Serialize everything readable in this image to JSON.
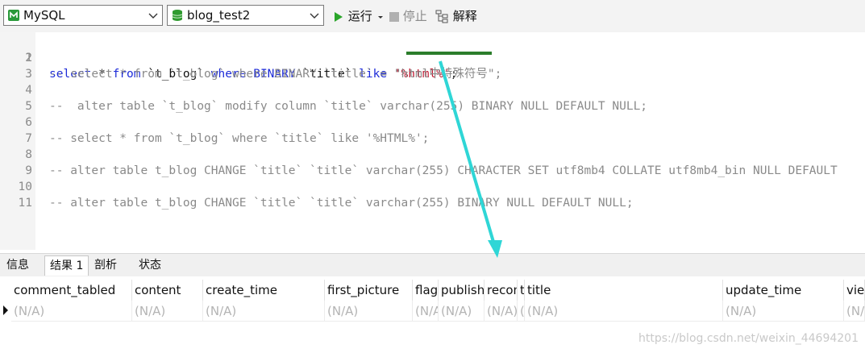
{
  "toolbar": {
    "connection": "MySQL",
    "database": "blog_test2",
    "run_label": "运行",
    "stop_label": "停止",
    "explain_label": "解释",
    "colors": {
      "run": "#2aa52a",
      "db_icon": "#2f9a2f"
    }
  },
  "editor": {
    "lines": [
      {
        "num": "1",
        "kind": "sql"
      },
      {
        "num": "2",
        "text": ""
      },
      {
        "num": "3",
        "text": "-- select * from `t_blog` where BINARY `title` = \"html中特殊符号\";"
      },
      {
        "num": "4",
        "text": ""
      },
      {
        "num": "5",
        "text": "--  alter table `t_blog` modify column `title` varchar(255) BINARY NULL DEFAULT NULL;"
      },
      {
        "num": "6",
        "text": ""
      },
      {
        "num": "7",
        "text": "-- select * from `t_blog` where `title` like '%HTML%';"
      },
      {
        "num": "8",
        "text": ""
      },
      {
        "num": "9",
        "text": "-- alter table t_blog CHANGE `title` `title` varchar(255) CHARACTER SET utf8mb4 COLLATE utf8mb4_bin NULL DEFAULT"
      },
      {
        "num": "10",
        "text": ""
      },
      {
        "num": "11",
        "text": "-- alter table t_blog CHANGE `title` `title` varchar(255) BINARY NULL DEFAULT NULL;"
      }
    ],
    "line1": {
      "kw_select": "select",
      "star": " * ",
      "kw_from": "from",
      "table": " `t_blog` ",
      "kw_where": "where",
      "kw_binary": " BINARY ",
      "col": "`title` ",
      "kw_like": "like",
      "space": " ",
      "pattern": "'%html%'",
      "semi": ";"
    },
    "colors": {
      "keyword": "#1d2bd8",
      "string": "#c0162f",
      "comment": "#8a8a8a"
    }
  },
  "tabs": [
    "信息",
    "结果 1",
    "剖析",
    "状态"
  ],
  "grid": {
    "columns": [
      "comment_tabled",
      "content",
      "create_time",
      "first_picture",
      "flag",
      "publish",
      "recom",
      "t",
      "title",
      "update_time",
      "view"
    ],
    "row": [
      "(N/A)",
      "(N/A)",
      "(N/A)",
      "(N/A)",
      "(N/A)",
      "(N/A)",
      "(N/A)",
      "(",
      "(N/A)",
      "(N/A)",
      "(N/A)"
    ]
  },
  "annotation": {
    "underline_color": "#2b7d2b",
    "arrow_color": "#2fd6d6"
  },
  "watermark": "https://blog.csdn.net/weixin_44694201"
}
